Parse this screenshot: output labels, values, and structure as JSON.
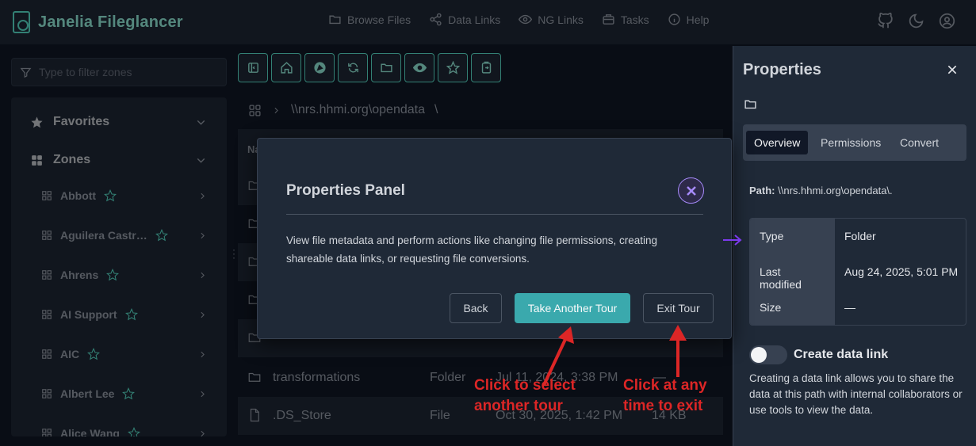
{
  "app": {
    "title": "Janelia Fileglancer"
  },
  "nav": [
    {
      "label": "Browse Files",
      "icon": "folder-icon"
    },
    {
      "label": "Data Links",
      "icon": "share-icon"
    },
    {
      "label": "NG Links",
      "icon": "eye-icon"
    },
    {
      "label": "Tasks",
      "icon": "briefcase-icon"
    },
    {
      "label": "Help",
      "icon": "info-icon"
    }
  ],
  "header_icons": [
    "github-icon",
    "moon-icon",
    "user-icon"
  ],
  "sidebar": {
    "filter_placeholder": "Type to filter zones",
    "favorites_label": "Favorites",
    "zones_label": "Zones",
    "zones": [
      "Abbott",
      "Aguilera Castr…",
      "Ahrens",
      "AI Support",
      "AIC",
      "Albert Lee",
      "Alice Wang"
    ]
  },
  "toolbar_icons": [
    "sidebar-toggle-icon",
    "home-icon",
    "navigate-icon",
    "refresh-icon",
    "new-folder-icon",
    "eye-icon",
    "star-icon",
    "clipboard-icon"
  ],
  "breadcrumb": {
    "path": "\\\\nrs.hhmi.org\\opendata",
    "sep": "\\"
  },
  "file_table": {
    "header": "Na",
    "rows": [
      {
        "name": "transformations",
        "type": "Folder",
        "modified": "Jul 11, 2024, 3:38 PM",
        "size": "—"
      },
      {
        "name": ".DS_Store",
        "type": "File",
        "modified": "Oct 30, 2025, 1:42 PM",
        "size": "14 KB"
      }
    ]
  },
  "properties": {
    "title": "Properties",
    "tabs": [
      "Overview",
      "Permissions",
      "Convert"
    ],
    "path_label": "Path:",
    "path_value": "\\\\nrs.hhmi.org\\opendata\\.",
    "meta": [
      {
        "k": "Type",
        "v": "Folder"
      },
      {
        "k": "Last modified",
        "v": "Aug 24, 2025, 5:01 PM"
      },
      {
        "k": "Size",
        "v": "—"
      }
    ],
    "data_link_label": "Create data link",
    "data_link_desc": "Creating a data link allows you to share the data at this path with internal collaborators or use tools to view the data."
  },
  "dialog": {
    "title": "Properties Panel",
    "body": "View file metadata and perform actions like changing file permissions, creating shareable data links, or requesting file conversions.",
    "back": "Back",
    "another": "Take Another Tour",
    "exit": "Exit Tour"
  },
  "annotations": {
    "select_line1": "Click to select",
    "select_line2": "another tour",
    "exit_line1": "Click at any",
    "exit_line2": "time to exit",
    "color": "#dc2626"
  }
}
